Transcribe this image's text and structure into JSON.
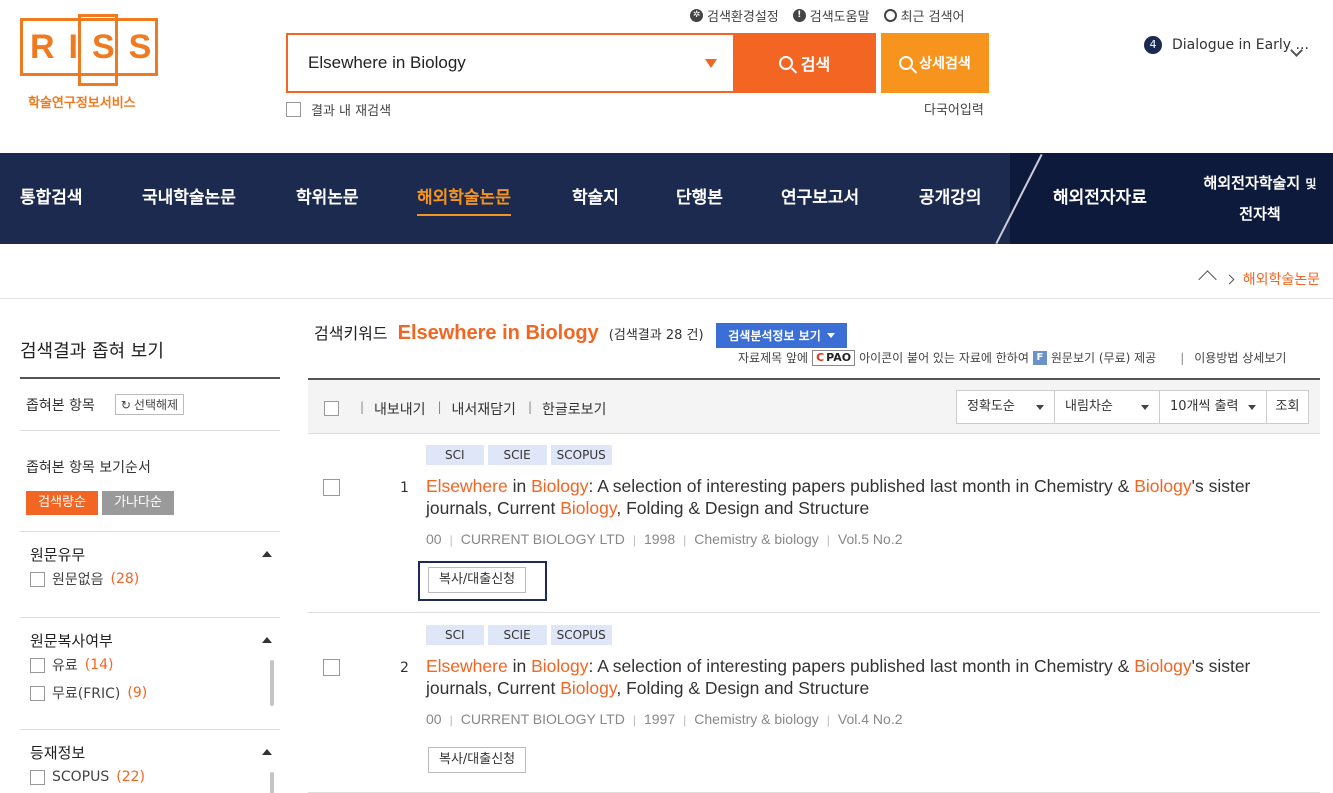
{
  "logo": {
    "text": "RISS",
    "subtitle": "학술연구정보서비스"
  },
  "util": {
    "settings": "검색환경설정",
    "help": "검색도움말",
    "recent": "최근 검색어"
  },
  "search": {
    "value": "Elsewhere in Biology",
    "button": "검색",
    "advanced": "상세검색",
    "re_search": "결과 내 재검색",
    "multi_lang": "다국어입력"
  },
  "rank": {
    "number": "4",
    "text": "Dialogue in Early ..."
  },
  "nav": {
    "items": [
      "통합검색",
      "국내학술논문",
      "학위논문",
      "해외학술논문",
      "학술지",
      "단행본",
      "연구보고서",
      "공개강의",
      "해외전자자료"
    ],
    "active_index": 3,
    "last_line1": "해외전자학술지",
    "last_small": "및",
    "last_line2": "전자책"
  },
  "breadcrumb": {
    "current": "해외학술논문"
  },
  "sidebar": {
    "title": "검색결과 좁혀 보기",
    "selected_label": "좁혀본 항목",
    "reset": "선택해제",
    "order_label": "좁혀본 항목 보기순서",
    "order_buttons": [
      "검색량순",
      "가나다순"
    ],
    "facets": [
      {
        "title": "원문유무",
        "items": [
          {
            "label": "원문없음",
            "count": "(28)"
          }
        ]
      },
      {
        "title": "원문복사여부",
        "items": [
          {
            "label": "유료",
            "count": "(14)"
          },
          {
            "label": "무료(FRIC)",
            "count": "(9)"
          }
        ]
      },
      {
        "title": "등재정보",
        "items": [
          {
            "label": "SCOPUS",
            "count": "(22)"
          }
        ]
      }
    ]
  },
  "main": {
    "keyword_label": "검색키워드",
    "keyword": "Elsewhere in Biology",
    "result_count": "(검색결과 28 건)",
    "analysis_button": "검색분석정보 보기",
    "notice_pre": "자료제목 앞에",
    "pao_label": "PAO",
    "notice_mid": "아이콘이 붙어 있는 자료에 한하여",
    "f_badge": "F",
    "notice_post": "원문보기 (무료) 제공",
    "usage_link": "이용방법 상세보기"
  },
  "toolbar": {
    "links": [
      "내보내기",
      "내서재담기",
      "한글로보기"
    ],
    "sort": "정확도순",
    "order": "내림차순",
    "per_page": "10개씩 출력",
    "view": "조회"
  },
  "results": [
    {
      "num": "1",
      "tags": [
        "SCI",
        "SCIE",
        "SCOPUS"
      ],
      "title": {
        "hl1": "Elsewhere",
        "t1": " in ",
        "hl2": "Biology",
        "t2": ": A selection of interesting papers published last month in Chemistry & ",
        "hl3": "Biology",
        "t3": "'s sister journals, Current ",
        "hl4": "Biology",
        "t4": ", Folding & Design and Structure"
      },
      "meta": [
        "00",
        "CURRENT BIOLOGY LTD",
        "1998",
        "Chemistry & biology",
        "Vol.5 No.2"
      ],
      "request": "복사/대출신청"
    },
    {
      "num": "2",
      "tags": [
        "SCI",
        "SCIE",
        "SCOPUS"
      ],
      "title": {
        "hl1": "Elsewhere",
        "t1": " in ",
        "hl2": "Biology",
        "t2": ": A selection of interesting papers published last month in Chemistry & ",
        "hl3": "Biology",
        "t3": "'s sister journals, Current ",
        "hl4": "Biology",
        "t4": ", Folding & Design and Structure"
      },
      "meta": [
        "00",
        "CURRENT BIOLOGY LTD",
        "1997",
        "Chemistry & biology",
        "Vol.4 No.2"
      ],
      "request": "복사/대출신청"
    }
  ],
  "colors": {
    "accent": "#f26522",
    "nav_bg": "#1d2a4f",
    "nav_active": "#f7941d",
    "tag_bg": "#dfe6f7",
    "button_blue": "#3c6fd6"
  }
}
